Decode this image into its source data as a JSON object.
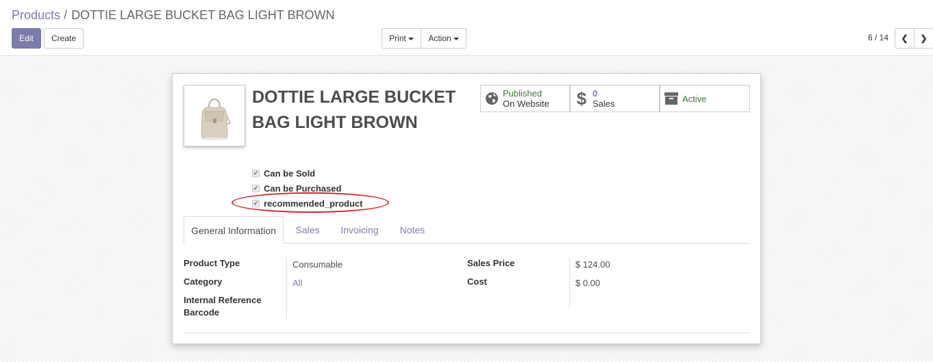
{
  "breadcrumb": {
    "parent": "Products",
    "separator": "/",
    "current": "DOTTIE LARGE BUCKET BAG LIGHT BROWN"
  },
  "toolbar": {
    "edit_label": "Edit",
    "create_label": "Create",
    "print_label": "Print",
    "action_label": "Action"
  },
  "pager": {
    "value": "6 / 14"
  },
  "product": {
    "name": "DOTTIE LARGE BUCKET BAG LIGHT BROWN",
    "image_icon": "bucket-bag-image"
  },
  "checkboxes": [
    {
      "label": "Can be Sold",
      "checked": true
    },
    {
      "label": "Can be Purchased",
      "checked": true
    },
    {
      "label": "recommended_product",
      "checked": true
    }
  ],
  "annotation_color": "#d4262f",
  "stat_buttons": {
    "published": {
      "line1": "Published",
      "line2": "On Website",
      "icon": "globe-icon"
    },
    "sales": {
      "count": "0",
      "label": "Sales",
      "icon": "dollar-icon"
    },
    "active": {
      "label": "Active",
      "icon": "archive-icon"
    }
  },
  "tabs": [
    "General Information",
    "Sales",
    "Invoicing",
    "Notes"
  ],
  "fields_left": [
    {
      "label": "Product Type",
      "value": "Consumable"
    },
    {
      "label": "Category",
      "value": "All"
    },
    {
      "label": "Internal Reference",
      "value": ""
    },
    {
      "label": "Barcode",
      "value": ""
    }
  ],
  "fields_right": [
    {
      "label": "Sales Price",
      "value": "$ 124.00"
    },
    {
      "label": "Cost",
      "value": "$ 0.00"
    }
  ],
  "colors": {
    "brand": "#7c7bad",
    "active_green": "#3c763d"
  }
}
